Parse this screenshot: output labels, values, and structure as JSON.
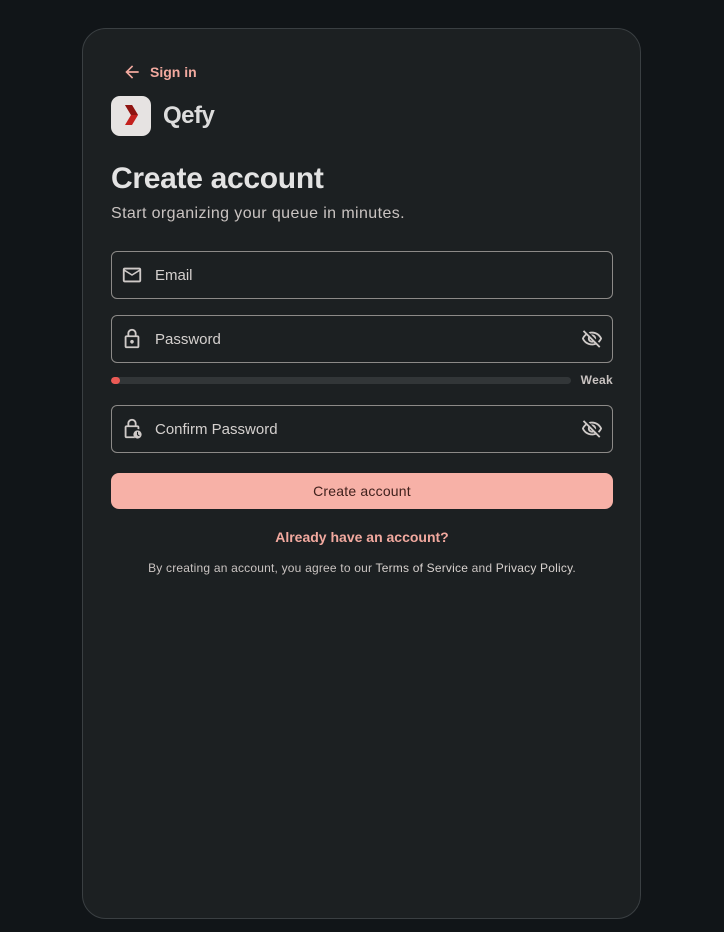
{
  "header": {
    "back_label": "Sign in",
    "brand_name": "Qefy"
  },
  "main": {
    "title": "Create account",
    "subtitle": "Start organizing your queue in minutes."
  },
  "form": {
    "email": {
      "placeholder": "Email",
      "value": ""
    },
    "password": {
      "placeholder": "Password",
      "value": ""
    },
    "confirm_password": {
      "placeholder": "Confirm Password",
      "value": ""
    },
    "strength": {
      "label": "Weak",
      "level_percent": 2
    },
    "submit_label": "Create account",
    "signin_link": "Already have an account?"
  },
  "legal": {
    "prefix": "By creating an account, you agree to our ",
    "terms_link": "Terms of Service",
    "conjunction": " and ",
    "privacy_link": "Privacy Policy",
    "suffix": "."
  },
  "icons": {
    "back": "arrow-left-icon",
    "logo": "qefy-logo",
    "email": "mail-icon",
    "password": "lock-icon",
    "confirm": "lock-clock-icon",
    "toggle": "eye-off-icon"
  },
  "colors": {
    "accent": "#f7b1a7",
    "link": "#f2a99f",
    "strength_weak": "#ea5a55",
    "background": "#111518",
    "card": "#1c2022"
  }
}
